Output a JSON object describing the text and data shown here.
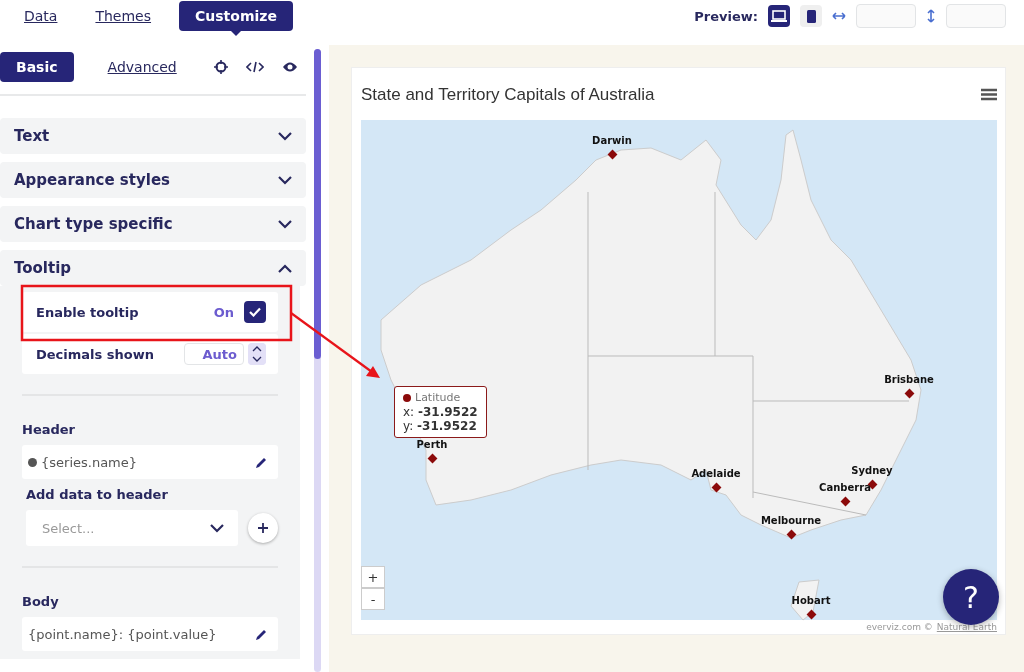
{
  "top_tabs": [
    {
      "label": "Data",
      "selected": false
    },
    {
      "label": "Themes",
      "selected": false
    },
    {
      "label": "Customize",
      "selected": true
    }
  ],
  "preview": {
    "label": "Preview:",
    "devices": [
      {
        "kind": "desktop",
        "selected": true
      },
      {
        "kind": "mobile",
        "selected": false
      }
    ]
  },
  "mode_tabs": [
    {
      "label": "Basic",
      "selected": true
    },
    {
      "label": "Advanced",
      "selected": false
    }
  ],
  "sections": [
    {
      "title": "Text",
      "expanded": false
    },
    {
      "title": "Appearance styles",
      "expanded": false
    },
    {
      "title": "Chart type specific",
      "expanded": false
    },
    {
      "title": "Tooltip",
      "expanded": true
    }
  ],
  "tooltip_settings": {
    "enable": {
      "label": "Enable tooltip",
      "state_text": "On",
      "checked": true
    },
    "decimals": {
      "label": "Decimals shown",
      "value": "Auto"
    },
    "header": {
      "label": "Header",
      "value": "{series.name}"
    },
    "add_data": {
      "label": "Add data to header",
      "placeholder": "Select..."
    },
    "body": {
      "label": "Body",
      "value": "{point.name}: {point.value}"
    }
  },
  "chart": {
    "title": "State and Territory Capitals of Australia",
    "cities": [
      {
        "name": "Darwin"
      },
      {
        "name": "Brisbane"
      },
      {
        "name": "Perth"
      },
      {
        "name": "Adelaide"
      },
      {
        "name": "Sydney"
      },
      {
        "name": "Canberra"
      },
      {
        "name": "Melbourne"
      },
      {
        "name": "Hobart"
      }
    ],
    "tooltip": {
      "series": "Latitude",
      "lines": [
        "x: **-31.9522**",
        "y: **-31.9522**"
      ]
    },
    "zoom_buttons": [
      "+",
      "-"
    ],
    "credit": "everviz.com ©",
    "credit_link": "Natural Earth"
  },
  "help": "?"
}
